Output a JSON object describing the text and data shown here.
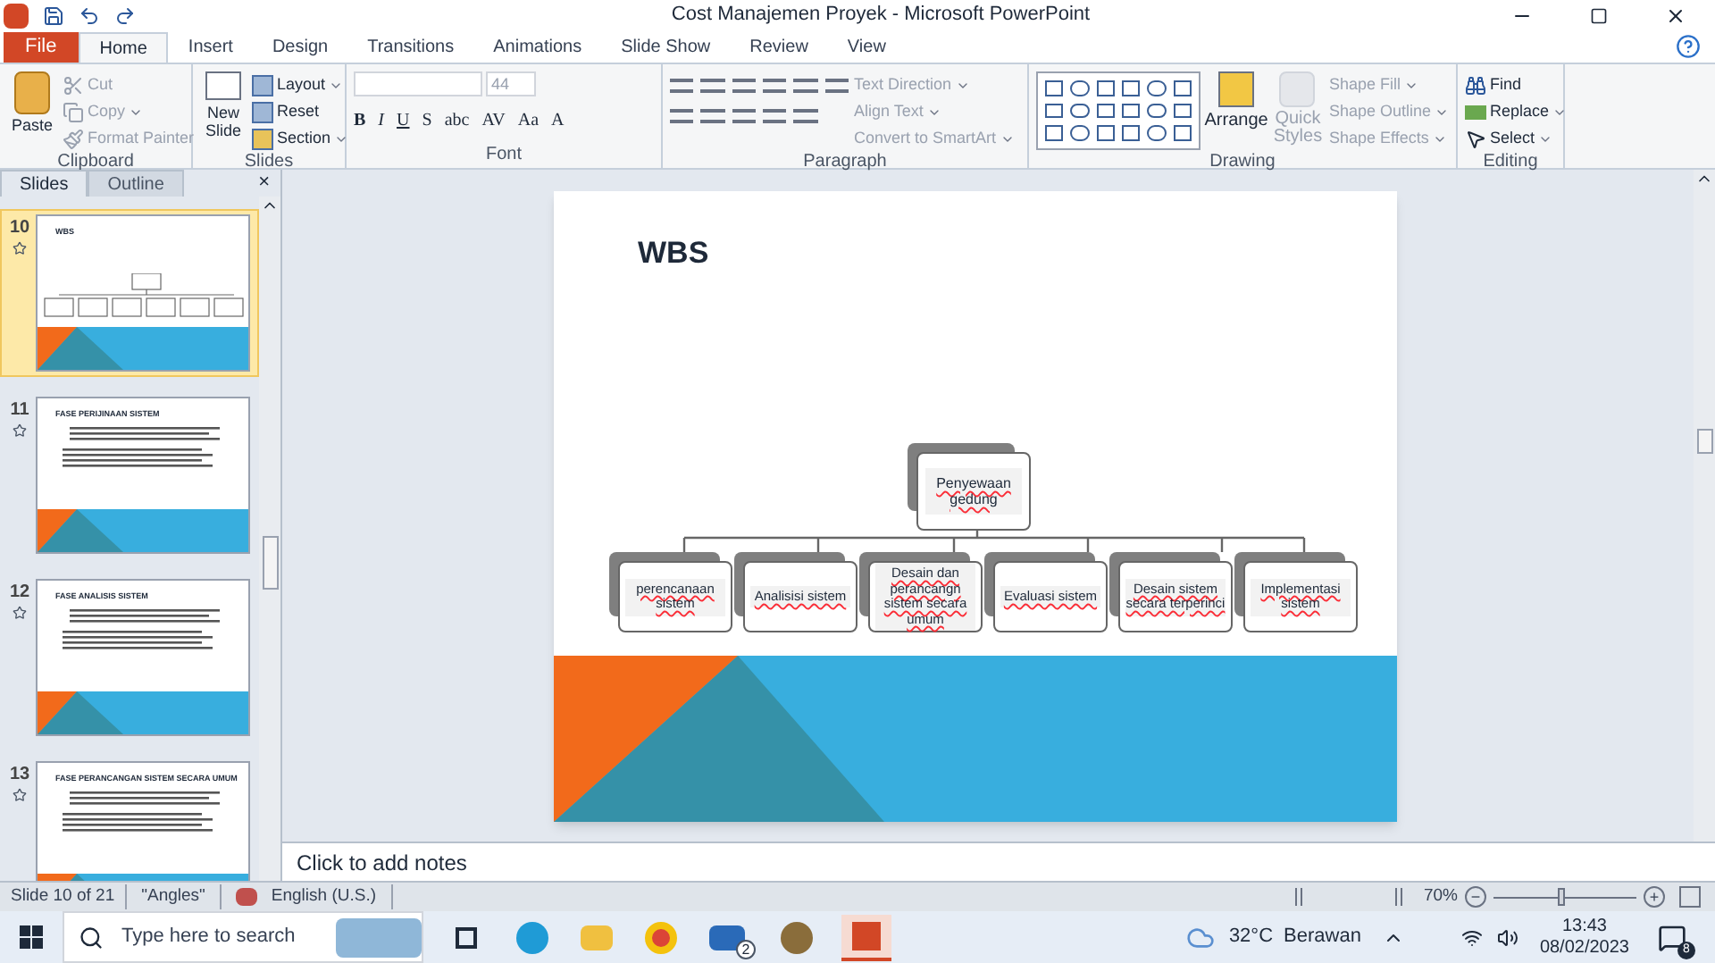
{
  "window": {
    "title": "Cost Manajemen Proyek  -  Microsoft PowerPoint"
  },
  "tabs": [
    {
      "label": "File",
      "kind": "file",
      "selected": false
    },
    {
      "label": "Home",
      "kind": "tab",
      "selected": true
    },
    {
      "label": "Insert",
      "kind": "tab",
      "selected": false
    },
    {
      "label": "Design",
      "kind": "tab",
      "selected": false
    },
    {
      "label": "Transitions",
      "kind": "tab",
      "selected": false
    },
    {
      "label": "Animations",
      "kind": "tab",
      "selected": false
    },
    {
      "label": "Slide Show",
      "kind": "tab",
      "selected": false
    },
    {
      "label": "Review",
      "kind": "tab",
      "selected": false
    },
    {
      "label": "View",
      "kind": "tab",
      "selected": false
    }
  ],
  "ribbon": {
    "clipboard": {
      "label": "Clipboard",
      "paste": "Paste",
      "cut": "Cut",
      "copy": "Copy",
      "format_painter": "Format Painter"
    },
    "slides": {
      "label": "Slides",
      "new_slide": "New Slide",
      "layout": "Layout",
      "reset": "Reset",
      "section": "Section"
    },
    "font": {
      "label": "Font",
      "size": "44",
      "buttons": [
        "B",
        "I",
        "U",
        "S",
        "abc",
        "AV",
        "Aa",
        "A"
      ]
    },
    "paragraph": {
      "label": "Paragraph",
      "text_direction": "Text Direction",
      "align_text": "Align Text",
      "convert": "Convert to SmartArt"
    },
    "drawing": {
      "label": "Drawing",
      "arrange": "Arrange",
      "quick_styles": "Quick Styles",
      "shape_fill": "Shape Fill",
      "shape_outline": "Shape Outline",
      "shape_effects": "Shape Effects"
    },
    "editing": {
      "label": "Editing",
      "find": "Find",
      "replace": "Replace",
      "select": "Select"
    }
  },
  "slide_panel": {
    "tabs": [
      {
        "label": "Slides",
        "selected": true
      },
      {
        "label": "Outline",
        "selected": false
      }
    ],
    "close": "×",
    "thumbnails": [
      {
        "number": "10",
        "title": "WBS",
        "kind": "chart",
        "selected": true
      },
      {
        "number": "11",
        "title": "FASE PERIJINAAN SISTEM",
        "kind": "text",
        "selected": false
      },
      {
        "number": "12",
        "title": "FASE ANALISIS SISTEM",
        "kind": "text",
        "selected": false
      },
      {
        "number": "13",
        "title": "FASE PERANCANGAN SISTEM SECARA UMUM",
        "kind": "text",
        "selected": false
      }
    ]
  },
  "slide": {
    "title": "WBS",
    "root": "Penyewaan gedung",
    "children": [
      "perencanaan sistem",
      "Analisisi sistem",
      "Desain dan perancangn sistem secara umum",
      "Evaluasi sistem",
      "Desain sistem secara terperinci",
      "Implementasi sistem"
    ]
  },
  "notes": {
    "placeholder": "Click to add notes"
  },
  "status_bar": {
    "slide": "Slide 10 of 21",
    "theme": "\"Angles\"",
    "language": "English (U.S.)",
    "zoom": "70%",
    "zoom_out": "−",
    "zoom_in": "+",
    "zoom_slider": {
      "level": 0.48
    }
  },
  "taskbar": {
    "search_placeholder": "Type here to search",
    "mail_badge": "2",
    "temperature": "32°C",
    "weather": "Berawan",
    "time": "13:43",
    "date": "08/02/2023",
    "notifications": "8"
  }
}
